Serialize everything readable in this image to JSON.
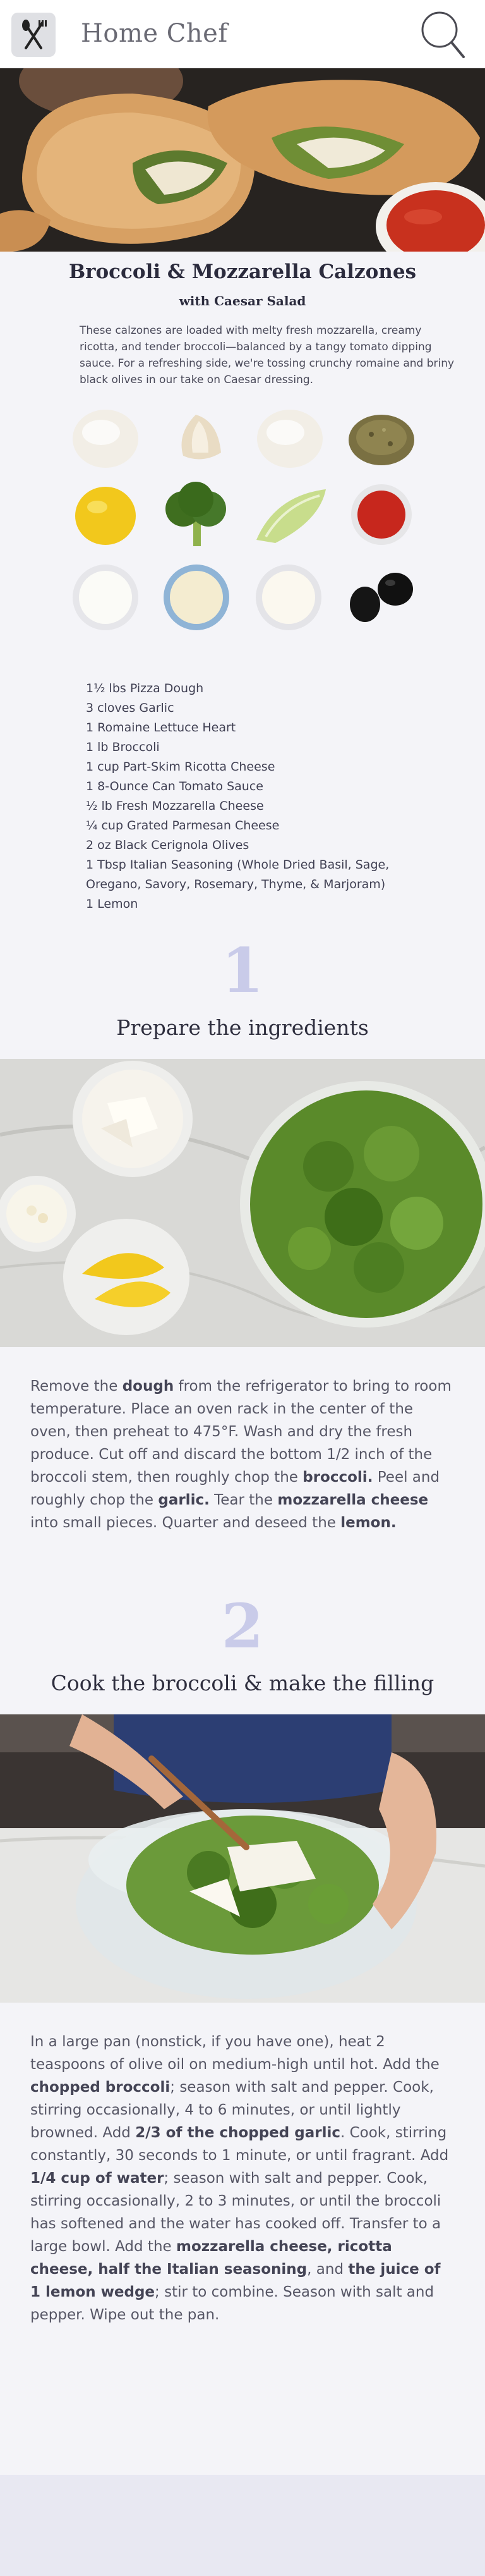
{
  "app": {
    "title": "Home Chef"
  },
  "recipe": {
    "title": "Broccoli & Mozzarella Calzones",
    "subtitle": "with Caesar Salad",
    "description": "These calzones are loaded with melty fresh mozzarella, creamy ricotta, and tender broccoli—balanced by a tangy tomato dipping sauce. For a refreshing side, we're tossing crunchy romaine and briny black olives in our take on Caesar dressing."
  },
  "ingredients": [
    "1½ lbs Pizza Dough",
    "3 cloves Garlic",
    "1 Romaine Lettuce Heart",
    "1 lb Broccoli",
    "1 cup Part-Skim Ricotta Cheese",
    "1 8-Ounce Can Tomato Sauce",
    "½ lb Fresh Mozzarella Cheese",
    "¼ cup Grated Parmesan Cheese",
    "2 oz Black Cerignola Olives",
    "1 Tbsp Italian Seasoning (Whole Dried Basil, Sage,",
    "Oregano, Savory, Rosemary, Thyme, & Marjoram)",
    "1 Lemon"
  ],
  "steps": [
    {
      "number": "1",
      "title": "Prepare the ingredients",
      "segments": [
        {
          "t": "Remove the ",
          "b": false
        },
        {
          "t": "dough",
          "b": true
        },
        {
          "t": " from the refrigerator to bring to room temperature. Place an oven rack in the center of the oven, then preheat to 475°F. Wash and dry the fresh produce. Cut off and discard the bottom 1/2 inch of the broccoli stem, then roughly chop the ",
          "b": false
        },
        {
          "t": "broccoli.",
          "b": true
        },
        {
          "t": " Peel and roughly chop the ",
          "b": false
        },
        {
          "t": "garlic.",
          "b": true
        },
        {
          "t": " Tear the ",
          "b": false
        },
        {
          "t": "mozzarella cheese",
          "b": true
        },
        {
          "t": " into small pieces. Quarter and deseed the ",
          "b": false
        },
        {
          "t": "lemon.",
          "b": true
        }
      ]
    },
    {
      "number": "2",
      "title": "Cook the broccoli & make the filling",
      "segments": [
        {
          "t": "In a large pan (nonstick, if you have one), heat 2 teaspoons of olive oil on medium-high until hot. Add the ",
          "b": false
        },
        {
          "t": "chopped broccoli",
          "b": true
        },
        {
          "t": "; season with salt and pepper. Cook, stirring occasionally, 4 to 6 minutes, or until lightly browned. Add ",
          "b": false
        },
        {
          "t": "2/3 of the chopped garlic",
          "b": true
        },
        {
          "t": ". Cook, stirring constantly, 30 seconds to 1 minute, or until fragrant. Add ",
          "b": false
        },
        {
          "t": "1/4 cup of water",
          "b": true
        },
        {
          "t": "; season with salt and pepper. Cook, stirring occasionally, 2 to 3 minutes, or until the broccoli has softened and the water has cooked off. Transfer to a large bowl. Add the ",
          "b": false
        },
        {
          "t": "mozzarella cheese, ricotta cheese, half the Italian seasoning",
          "b": true
        },
        {
          "t": ", and ",
          "b": false
        },
        {
          "t": "the juice of 1 lemon wedge",
          "b": true
        },
        {
          "t": "; stir to combine. Season with salt and pepper. Wipe out the pan.",
          "b": false
        }
      ]
    }
  ],
  "icons": {
    "logo": "chef-utensils-logo-icon",
    "search": "search-icon"
  }
}
